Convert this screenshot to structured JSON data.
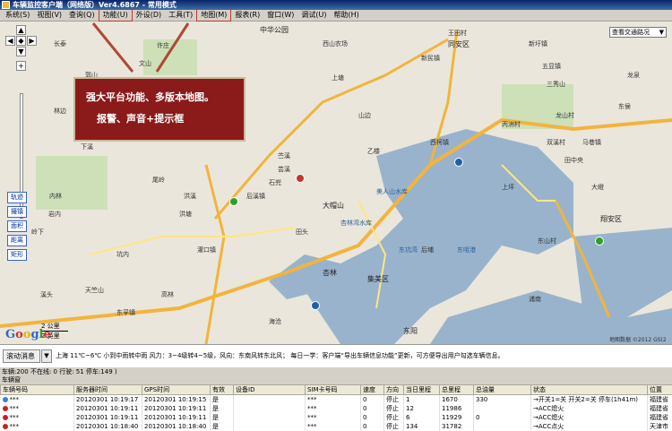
{
  "window": {
    "title": "车辆监控客户端（网络版）Ver4.6867 - 常用模式"
  },
  "menu": [
    {
      "label": "系统(S)",
      "hl": false
    },
    {
      "label": "视图(V)",
      "hl": false
    },
    {
      "label": "查询(Q)",
      "hl": false
    },
    {
      "label": "功能(U)",
      "hl": true
    },
    {
      "label": "外设(D)",
      "hl": false
    },
    {
      "label": "工具(T)",
      "hl": false
    },
    {
      "label": "地图(M)",
      "hl": true
    },
    {
      "label": "报表(R)",
      "hl": false
    },
    {
      "label": "窗口(W)",
      "hl": false
    },
    {
      "label": "调试(U)",
      "hl": false
    },
    {
      "label": "帮助(H)",
      "hl": false
    }
  ],
  "map": {
    "traffic_select": "查看交通路况",
    "promo_line1": "强大平台功能、多版本地图。",
    "promo_line2": "报警、声音+提示框",
    "tools": [
      "轨迹",
      "撮镇",
      "面积",
      "距离",
      "矩形"
    ],
    "scale_km": "2 公里",
    "scale_mi": "2 英里",
    "google_logo": "Google",
    "copyright": "地图数据 ©2012 GS(2",
    "labels": [
      "中华公园",
      "西山农场",
      "同安区",
      "上塘",
      "西柯镇",
      "丙洲村",
      "杏林",
      "集美区",
      "海沧",
      "东孚镇",
      "新民镇",
      "五显镇",
      "汀溪镇",
      "莲花镇",
      "大嶝",
      "马巷镇",
      "东阳",
      "翔安区",
      "新圩镇",
      "后溪镇",
      "灌口镇",
      "大帽山",
      "美人山水库",
      "东咀港",
      "东山村",
      "三秀山",
      "下溪",
      "石兜",
      "田头",
      "内林",
      "天竺山",
      "王田村",
      "杏林湾水库",
      "东坑湾",
      "坑内",
      "尾岭",
      "上坪",
      "洪溪",
      "郭山",
      "许庄",
      "山边",
      "东侯",
      "龙泉",
      "浦南",
      "龙山村",
      "双溪村",
      "田中央",
      "溪头",
      "高林",
      "苎溪",
      "乙楼",
      "芸溪",
      "长泰",
      "后埔",
      "岩内",
      "洪塘",
      "文山",
      "岭下",
      "莲塘",
      "林边"
    ]
  },
  "message_bar": {
    "button_label": "滚动消息",
    "dropdown": "▼",
    "text": "上海 11℃~6℃  小到中雨转中雨  风力：3~4级转4~5级，风向：东南风转东北风；      每日一学：客户端“导出车辆信息功能”更新，可方便导出用户勾选车辆信息。"
  },
  "status_line": "车辆:200 不在线: 0 行驶: 51 停车:149 )",
  "window_tab": "车辆窗",
  "table": {
    "columns": [
      "车辆号码",
      "服务器时间",
      "GPS时间",
      "有效",
      "设备ID",
      "SIM卡号码",
      "速度",
      "方向",
      "当日里程",
      "总里程",
      "总油量",
      "状态",
      "位置"
    ],
    "rows": [
      {
        "color": "#3a7be0",
        "cells": [
          "***",
          "20120301 10:19:17",
          "20120301 10:19:15",
          "是",
          "",
          "***",
          "0",
          "停止",
          "1",
          "1670",
          "330",
          "→开关1=关 开关2=关 停车(1h41m)",
          "福建省"
        ]
      },
      {
        "color": "#d21d1d",
        "cells": [
          "***",
          "20120301 10:19:11",
          "20120301 10:19:11",
          "是",
          "",
          "***",
          "0",
          "停止",
          "12",
          "11986",
          "",
          "→ACC熄火",
          "福建省"
        ]
      },
      {
        "color": "#d21d1d",
        "cells": [
          "***",
          "20120301 10:19:11",
          "20120301 10:19:11",
          "是",
          "",
          "***",
          "0",
          "停止",
          "6",
          "11929",
          "0",
          "→ACC熄火",
          "福建省"
        ]
      },
      {
        "color": "#d21d1d",
        "cells": [
          "***",
          "20120301 10:18:40",
          "20120301 10:18:40",
          "是",
          "",
          "***",
          "0",
          "停止",
          "134",
          "31782",
          "",
          "→ACC点火",
          "天津市"
        ]
      }
    ]
  }
}
